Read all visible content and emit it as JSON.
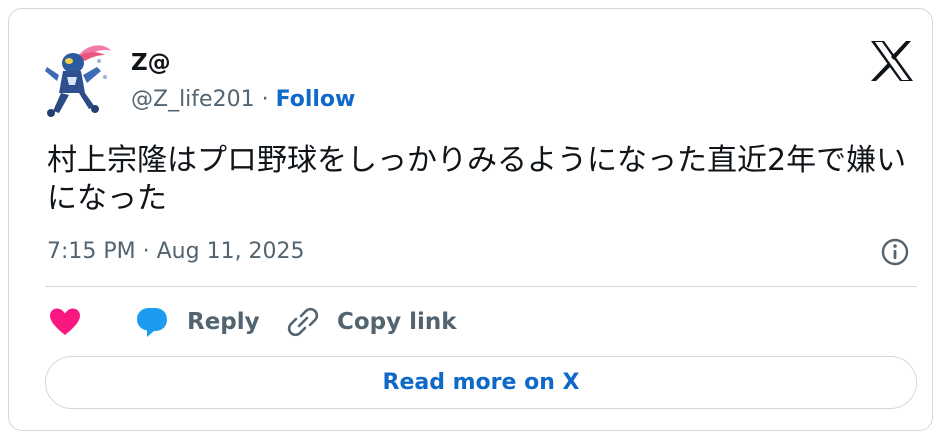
{
  "author": {
    "display_name": "Z@",
    "handle": "@Z_life201",
    "separator": "·",
    "follow_label": "Follow",
    "avatar_icon": "character-avatar"
  },
  "brand": {
    "logo_icon": "x-logo-icon"
  },
  "tweet": {
    "text": "村上宗隆はプロ野球をしっかりみるようになった直近2年で嫌いになった",
    "timestamp": "7:15 PM · Aug 11, 2025"
  },
  "actions": {
    "like_icon": "heart-icon",
    "reply_label": "Reply",
    "reply_icon": "speech-bubble-icon",
    "copy_label": "Copy link",
    "copy_icon": "link-icon",
    "info_icon": "info-icon"
  },
  "footer": {
    "read_more_label": "Read more on X"
  },
  "colors": {
    "heart": "#f91880",
    "reply_bubble": "#1d9bf0",
    "link_blue": "#0e69c9",
    "muted_text": "#536471",
    "border": "#cfd9de"
  }
}
